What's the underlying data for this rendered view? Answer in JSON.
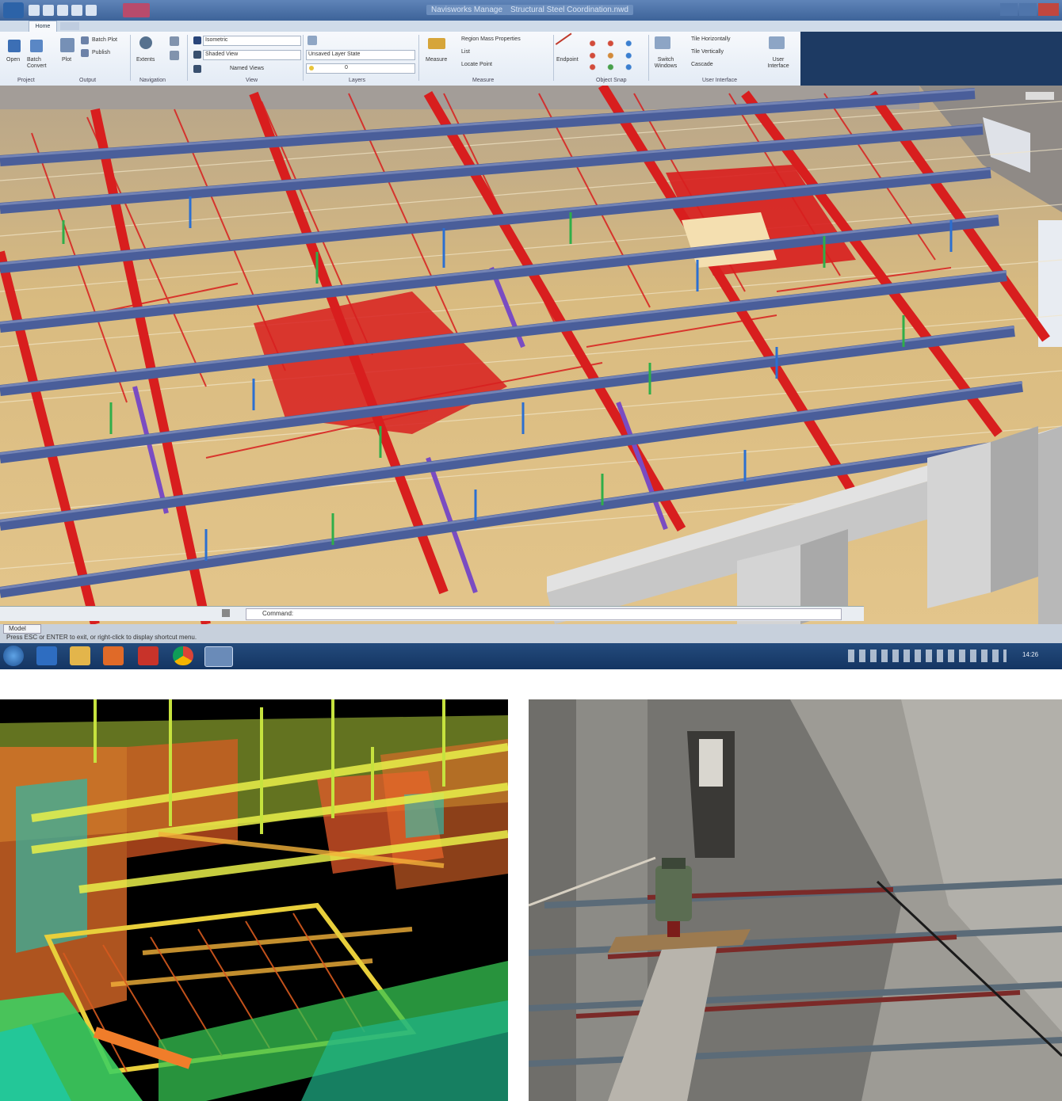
{
  "titlebar": {
    "app_caption": "Navisworks Manage",
    "document_caption": "Structural Steel Coordination.nwd"
  },
  "ribbon": {
    "tab_home": "Home",
    "groups": [
      {
        "name": "Project",
        "items": [
          "Open",
          "Batch Convert"
        ]
      },
      {
        "name": "Output",
        "items": [
          "Plot",
          "Batch Plot",
          "Publish"
        ]
      },
      {
        "name": "Navigation",
        "items": [
          "Extents"
        ]
      },
      {
        "name": "View",
        "items": [
          "Isometric",
          "Shaded View",
          "Named Views"
        ]
      },
      {
        "name": "Layers",
        "items": [
          "Unsaved Layer State",
          "0"
        ]
      },
      {
        "name": "Measure",
        "items": [
          "Measure",
          "Region Mass Properties",
          "List",
          "Locate Point"
        ]
      },
      {
        "name": "Object Snap",
        "items": [
          "Endpoint"
        ]
      },
      {
        "name": "User Interface",
        "items": [
          "Switch Windows",
          "Tile Horizontally",
          "Tile Vertically",
          "Cascade",
          "User Interface"
        ]
      }
    ]
  },
  "command": {
    "prompt_value": "Command:"
  },
  "statusbar": {
    "text": "Press ESC or ENTER to exit, or right-click to display shortcut menu.",
    "model_tab": "Model"
  },
  "taskbar": {
    "apps": [
      "start-icon",
      "ie-icon",
      "folder-icon",
      "media-icon",
      "pdf-icon",
      "chrome-icon",
      "cad-icon"
    ],
    "clock": "14:26"
  },
  "colors": {
    "steel_red": "#d81e1e",
    "joist_blue": "#4a5e9a",
    "deck_tan": "#d9b77c",
    "concrete_gray": "#bfbfbf"
  }
}
